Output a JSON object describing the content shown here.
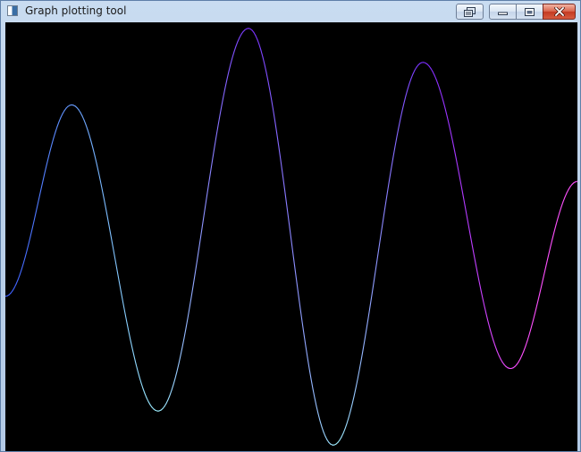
{
  "window": {
    "title": "Graph plotting tool",
    "icons": {
      "app": "application-icon",
      "extra": "restore-layout-icon",
      "minimize": "minimize-icon",
      "maximize": "maximize-icon",
      "close": "close-icon"
    }
  },
  "colors": {
    "plot_background": "#000000",
    "curve_start": "#3b5bff",
    "curve_mid_cyan": "#9ff0ff",
    "curve_mid_violet": "#7a2cff",
    "curve_end": "#ff50ff"
  },
  "chart_data": {
    "type": "line",
    "grid": false,
    "legend": "none",
    "series": [
      {
        "x": [
          0.0,
          0.116,
          0.267,
          0.425,
          0.573,
          0.73,
          0.883,
          1.0
        ],
        "y": [
          0.64,
          0.19,
          0.91,
          0.01,
          0.99,
          0.09,
          0.81,
          0.37
        ]
      }
    ]
  }
}
